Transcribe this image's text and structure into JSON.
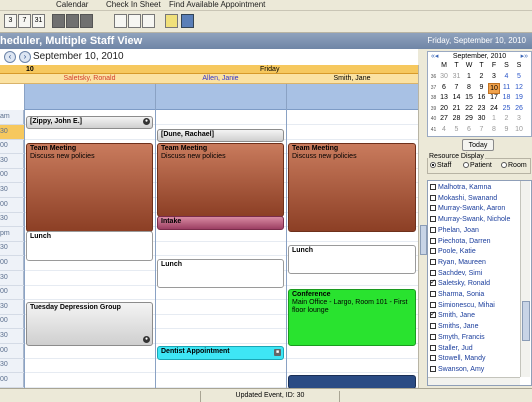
{
  "menu": [
    "Calendar",
    "Check In Sheet",
    "Find Available Appointment"
  ],
  "toolbar": {
    "buttons": [
      "3",
      "7",
      "31"
    ]
  },
  "title": "heduler, Multiple Staff View",
  "title_date": "Friday, September 10, 2010",
  "nav": {
    "date": "September 10, 2010"
  },
  "day": {
    "number": "10",
    "name": "Friday"
  },
  "staff": [
    {
      "name": "Saletsky, Ronald",
      "color": "#d23c2c"
    },
    {
      "name": "Allen, Janie",
      "color": "#3333cc"
    },
    {
      "name": "Smith, Jane",
      "color": "#000000"
    }
  ],
  "time_labels": [
    "am",
    "30",
    "00",
    "30",
    "00",
    "30",
    "00",
    "30",
    "pm",
    "30",
    "00",
    "30",
    "00",
    "30",
    "00",
    "30",
    "00",
    "30",
    "00"
  ],
  "events": {
    "zippy": {
      "title": "[Zippy, John E.]"
    },
    "dune": {
      "title": "[Dune, Rachael]"
    },
    "meeting": {
      "title": "Team Meeting",
      "desc": "Discuss new policies"
    },
    "intake": {
      "title": "Intake"
    },
    "lunch": {
      "title": "Lunch"
    },
    "depression": {
      "title": "Tuesday Depression Group"
    },
    "conference": {
      "title": "Conference",
      "desc": "Main Office - Largo, Room 101 - First floor lounge"
    },
    "dentist": {
      "title": "Dentist Appointment"
    }
  },
  "calendar": {
    "month_label": "September, 2010",
    "weekdays": [
      "M",
      "T",
      "W",
      "T",
      "F",
      "S",
      "S"
    ],
    "weeks": [
      "36",
      "37",
      "38",
      "39",
      "40",
      "41"
    ],
    "days": [
      [
        "30",
        "31",
        "1",
        "2",
        "3",
        "4",
        "5"
      ],
      [
        "6",
        "7",
        "8",
        "9",
        "10",
        "11",
        "12"
      ],
      [
        "13",
        "14",
        "15",
        "16",
        "17",
        "18",
        "19"
      ],
      [
        "20",
        "21",
        "22",
        "23",
        "24",
        "25",
        "26"
      ],
      [
        "27",
        "28",
        "29",
        "30",
        "1",
        "2",
        "3"
      ],
      [
        "4",
        "5",
        "6",
        "7",
        "8",
        "9",
        "10"
      ]
    ],
    "today_label": "Today"
  },
  "resource_display": {
    "label": "Resource Display",
    "options": [
      "Staff",
      "Patient",
      "Room"
    ],
    "selected": "Staff"
  },
  "resources": [
    {
      "name": "Malhotra, Kamna",
      "checked": false
    },
    {
      "name": "Mokashi, Swanand",
      "checked": false
    },
    {
      "name": "Murray-Swank, Aaron",
      "checked": false
    },
    {
      "name": "Murray-Swank, Nichole",
      "checked": false
    },
    {
      "name": "Phelan, Joan",
      "checked": false
    },
    {
      "name": "Piechota, Darren",
      "checked": false
    },
    {
      "name": "Poole, Katie",
      "checked": false
    },
    {
      "name": "Ryan, Maureen",
      "checked": false
    },
    {
      "name": "Sachdev, Simi",
      "checked": false
    },
    {
      "name": "Saletsky, Ronald",
      "checked": true
    },
    {
      "name": "Sharma, Sonia",
      "checked": false
    },
    {
      "name": "Simionescu, Mihai",
      "checked": false
    },
    {
      "name": "Smith, Jane",
      "checked": true
    },
    {
      "name": "Smiths, Jane",
      "checked": false
    },
    {
      "name": "Smyth, Francis",
      "checked": false
    },
    {
      "name": "Staller, Jud",
      "checked": false
    },
    {
      "name": "Stowell, Mandy",
      "checked": false
    },
    {
      "name": "Swanson, Amy",
      "checked": false
    }
  ],
  "status": "Updated Event, ID: 30"
}
